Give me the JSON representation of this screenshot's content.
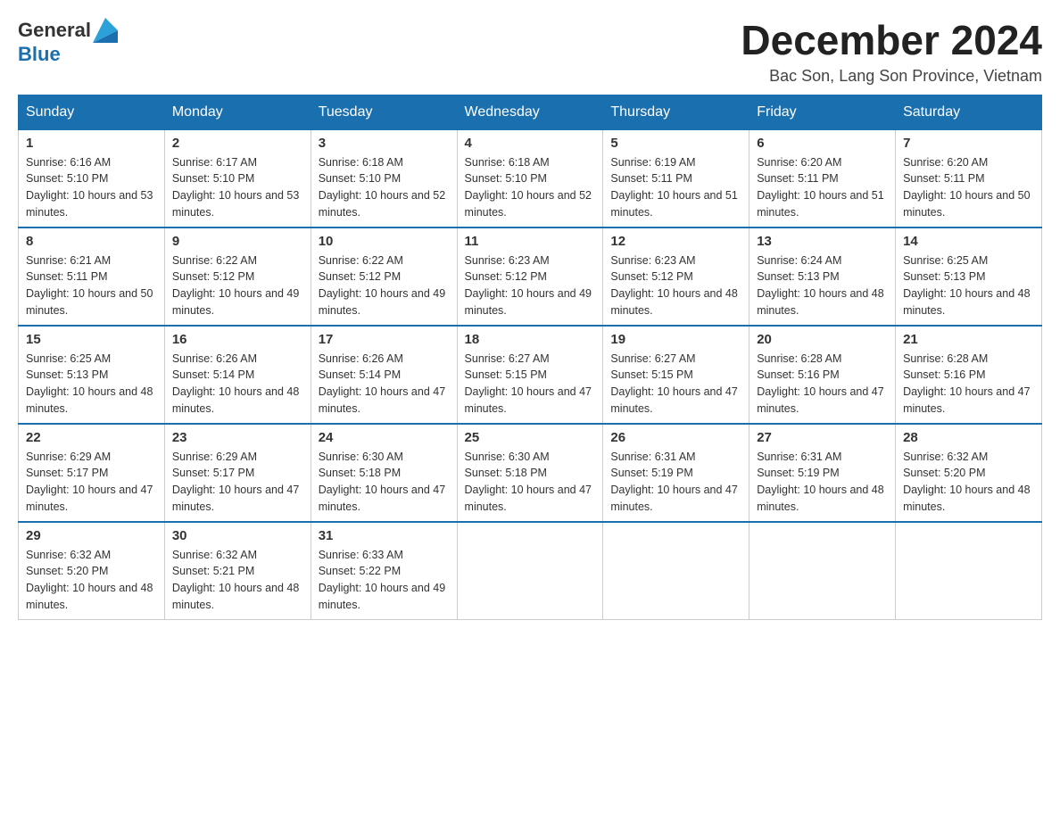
{
  "header": {
    "logo": {
      "text_general": "General",
      "text_blue": "Blue"
    },
    "month_year": "December 2024",
    "location": "Bac Son, Lang Son Province, Vietnam"
  },
  "days_of_week": [
    "Sunday",
    "Monday",
    "Tuesday",
    "Wednesday",
    "Thursday",
    "Friday",
    "Saturday"
  ],
  "weeks": [
    [
      {
        "day": "1",
        "sunrise": "6:16 AM",
        "sunset": "5:10 PM",
        "daylight": "10 hours and 53 minutes."
      },
      {
        "day": "2",
        "sunrise": "6:17 AM",
        "sunset": "5:10 PM",
        "daylight": "10 hours and 53 minutes."
      },
      {
        "day": "3",
        "sunrise": "6:18 AM",
        "sunset": "5:10 PM",
        "daylight": "10 hours and 52 minutes."
      },
      {
        "day": "4",
        "sunrise": "6:18 AM",
        "sunset": "5:10 PM",
        "daylight": "10 hours and 52 minutes."
      },
      {
        "day": "5",
        "sunrise": "6:19 AM",
        "sunset": "5:11 PM",
        "daylight": "10 hours and 51 minutes."
      },
      {
        "day": "6",
        "sunrise": "6:20 AM",
        "sunset": "5:11 PM",
        "daylight": "10 hours and 51 minutes."
      },
      {
        "day": "7",
        "sunrise": "6:20 AM",
        "sunset": "5:11 PM",
        "daylight": "10 hours and 50 minutes."
      }
    ],
    [
      {
        "day": "8",
        "sunrise": "6:21 AM",
        "sunset": "5:11 PM",
        "daylight": "10 hours and 50 minutes."
      },
      {
        "day": "9",
        "sunrise": "6:22 AM",
        "sunset": "5:12 PM",
        "daylight": "10 hours and 49 minutes."
      },
      {
        "day": "10",
        "sunrise": "6:22 AM",
        "sunset": "5:12 PM",
        "daylight": "10 hours and 49 minutes."
      },
      {
        "day": "11",
        "sunrise": "6:23 AM",
        "sunset": "5:12 PM",
        "daylight": "10 hours and 49 minutes."
      },
      {
        "day": "12",
        "sunrise": "6:23 AM",
        "sunset": "5:12 PM",
        "daylight": "10 hours and 48 minutes."
      },
      {
        "day": "13",
        "sunrise": "6:24 AM",
        "sunset": "5:13 PM",
        "daylight": "10 hours and 48 minutes."
      },
      {
        "day": "14",
        "sunrise": "6:25 AM",
        "sunset": "5:13 PM",
        "daylight": "10 hours and 48 minutes."
      }
    ],
    [
      {
        "day": "15",
        "sunrise": "6:25 AM",
        "sunset": "5:13 PM",
        "daylight": "10 hours and 48 minutes."
      },
      {
        "day": "16",
        "sunrise": "6:26 AM",
        "sunset": "5:14 PM",
        "daylight": "10 hours and 48 minutes."
      },
      {
        "day": "17",
        "sunrise": "6:26 AM",
        "sunset": "5:14 PM",
        "daylight": "10 hours and 47 minutes."
      },
      {
        "day": "18",
        "sunrise": "6:27 AM",
        "sunset": "5:15 PM",
        "daylight": "10 hours and 47 minutes."
      },
      {
        "day": "19",
        "sunrise": "6:27 AM",
        "sunset": "5:15 PM",
        "daylight": "10 hours and 47 minutes."
      },
      {
        "day": "20",
        "sunrise": "6:28 AM",
        "sunset": "5:16 PM",
        "daylight": "10 hours and 47 minutes."
      },
      {
        "day": "21",
        "sunrise": "6:28 AM",
        "sunset": "5:16 PM",
        "daylight": "10 hours and 47 minutes."
      }
    ],
    [
      {
        "day": "22",
        "sunrise": "6:29 AM",
        "sunset": "5:17 PM",
        "daylight": "10 hours and 47 minutes."
      },
      {
        "day": "23",
        "sunrise": "6:29 AM",
        "sunset": "5:17 PM",
        "daylight": "10 hours and 47 minutes."
      },
      {
        "day": "24",
        "sunrise": "6:30 AM",
        "sunset": "5:18 PM",
        "daylight": "10 hours and 47 minutes."
      },
      {
        "day": "25",
        "sunrise": "6:30 AM",
        "sunset": "5:18 PM",
        "daylight": "10 hours and 47 minutes."
      },
      {
        "day": "26",
        "sunrise": "6:31 AM",
        "sunset": "5:19 PM",
        "daylight": "10 hours and 47 minutes."
      },
      {
        "day": "27",
        "sunrise": "6:31 AM",
        "sunset": "5:19 PM",
        "daylight": "10 hours and 48 minutes."
      },
      {
        "day": "28",
        "sunrise": "6:32 AM",
        "sunset": "5:20 PM",
        "daylight": "10 hours and 48 minutes."
      }
    ],
    [
      {
        "day": "29",
        "sunrise": "6:32 AM",
        "sunset": "5:20 PM",
        "daylight": "10 hours and 48 minutes."
      },
      {
        "day": "30",
        "sunrise": "6:32 AM",
        "sunset": "5:21 PM",
        "daylight": "10 hours and 48 minutes."
      },
      {
        "day": "31",
        "sunrise": "6:33 AM",
        "sunset": "5:22 PM",
        "daylight": "10 hours and 49 minutes."
      },
      null,
      null,
      null,
      null
    ]
  ],
  "labels": {
    "sunrise_prefix": "Sunrise: ",
    "sunset_prefix": "Sunset: ",
    "daylight_prefix": "Daylight: "
  }
}
